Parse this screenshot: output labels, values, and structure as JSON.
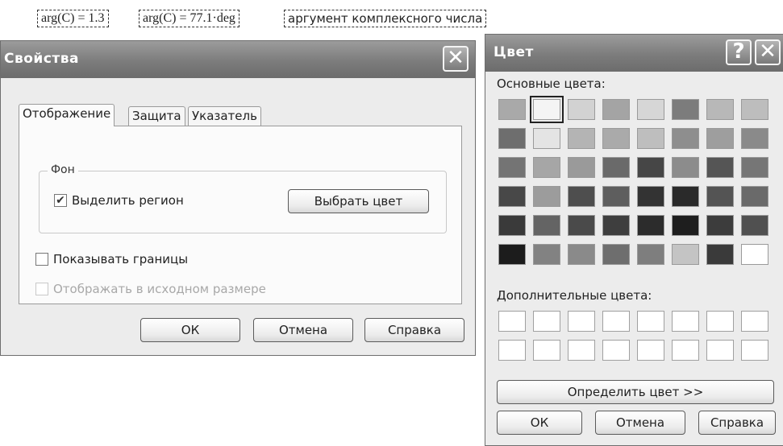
{
  "annotations": {
    "arg_rad": "arg(C) = 1.3",
    "arg_deg": "arg(C) = 77.1·deg",
    "caption": "аргумент комплексного числа"
  },
  "properties_dialog": {
    "title": "Свойства",
    "close_glyph": "✕",
    "tabs": [
      "Отображение",
      "Защита",
      "Указатель"
    ],
    "group_title": "Фон",
    "highlight_region_label": "Выделить регион",
    "highlight_region_checked": true,
    "check_glyph": "✔",
    "choose_color_label": "Выбрать цвет",
    "show_borders_label": "Показывать границы",
    "original_size_label": "Отображать в исходном размере",
    "ok_label": "ОК",
    "cancel_label": "Отмена",
    "help_label": "Справка"
  },
  "color_dialog": {
    "title": "Цвет",
    "help_glyph": "?",
    "close_glyph": "✕",
    "basic_colors_label": "Основные цвета:",
    "basic_colors": [
      [
        "#a9a9a9",
        "#f4f4f4",
        "#d2d2d2",
        "#a4a4a4",
        "#d6d6d6",
        "#7c7c7c",
        "#b8b8b8",
        "#bdbdbd"
      ],
      [
        "#6e6e6e",
        "#e4e4e4",
        "#b4b4b4",
        "#aaaaaa",
        "#bebebe",
        "#8e8e8e",
        "#9e9e9e",
        "#8a8a8a"
      ],
      [
        "#747474",
        "#a6a6a6",
        "#9a9a9a",
        "#6a6a6a",
        "#464646",
        "#8c8c8c",
        "#555555",
        "#767676"
      ],
      [
        "#484848",
        "#9c9c9c",
        "#4e4e4e",
        "#5e5e5e",
        "#333333",
        "#2a2a2a",
        "#545454",
        "#6a6a6a"
      ],
      [
        "#3a3a3a",
        "#646464",
        "#4a4a4a",
        "#3e3e3e",
        "#2c2c2c",
        "#1e1e1e",
        "#3c3c3c",
        "#505050"
      ],
      [
        "#1c1c1c",
        "#828282",
        "#8a8a8a",
        "#6e6e6e",
        "#7e7e7e",
        "#c4c4c4",
        "#3a3a3a",
        "#ffffff"
      ]
    ],
    "custom_colors_label": "Дополнительные цвета:",
    "define_label": "Определить цвет >>",
    "ok_label": "ОК",
    "cancel_label": "Отмена",
    "help_label": "Справка"
  }
}
